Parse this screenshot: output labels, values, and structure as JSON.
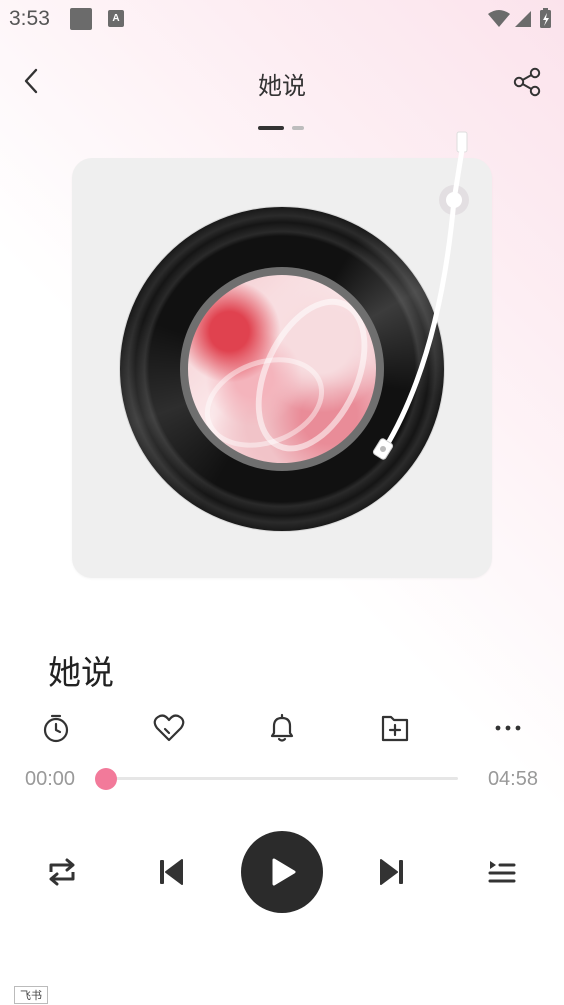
{
  "status_bar": {
    "time": "3:53",
    "app_icon_letter": "A"
  },
  "header": {
    "title": "她说"
  },
  "pager": {
    "active_index": 0,
    "count": 2
  },
  "song": {
    "title": "她说"
  },
  "actions": [
    {
      "name": "timer-icon"
    },
    {
      "name": "heart-icon"
    },
    {
      "name": "bell-icon"
    },
    {
      "name": "add-folder-icon"
    },
    {
      "name": "more-icon"
    }
  ],
  "progress": {
    "current": "00:00",
    "total": "04:58",
    "fraction": 0.0
  },
  "controls": {
    "repeat": "repeat-icon",
    "previous": "skip-previous-icon",
    "play": "play-icon",
    "next": "skip-next-icon",
    "playlist": "playlist-icon"
  },
  "colors": {
    "accent": "#f27a9a",
    "play_button": "#2b2b2b"
  },
  "footer_tag": "飞书"
}
